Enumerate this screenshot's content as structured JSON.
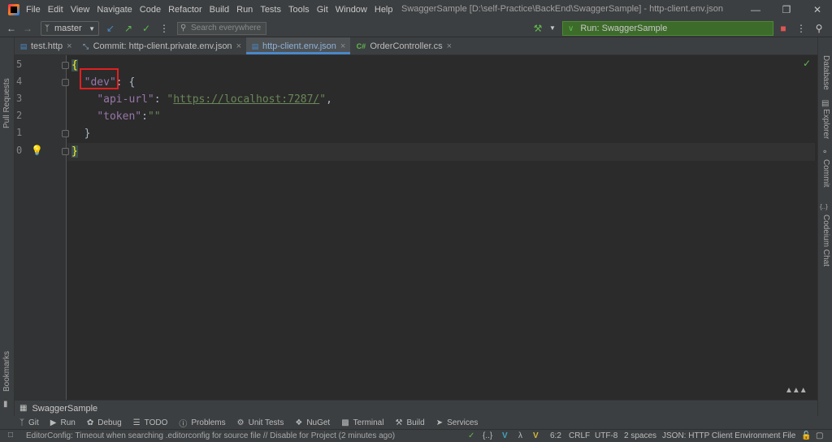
{
  "menu": [
    "File",
    "Edit",
    "View",
    "Navigate",
    "Code",
    "Refactor",
    "Build",
    "Run",
    "Tests",
    "Tools",
    "Git",
    "Window",
    "Help"
  ],
  "window_title": "SwaggerSample [D:\\self-Practice\\BackEnd\\SwaggerSample] - http-client.env.json",
  "toolbar": {
    "branch": "master",
    "search_placeholder": "Search everywhere",
    "run_config": "Run: SwaggerSample"
  },
  "left_stripe": {
    "pull_requests": "Pull Requests",
    "bookmarks": "Bookmarks"
  },
  "right_stripe": {
    "database": "Database",
    "explorer": "Explorer",
    "commit": "Commit",
    "codeium": "Codeium Chat"
  },
  "tabs": [
    {
      "label": "test.http",
      "active": false
    },
    {
      "label": "Commit: http-client.private.env.json",
      "active": false
    },
    {
      "label": "http-client.env.json",
      "active": true
    },
    {
      "label": "OrderController.cs",
      "active": false
    }
  ],
  "editor": {
    "line_numbers": [
      "5",
      "4",
      "3",
      "2",
      "1",
      "0"
    ],
    "lines": {
      "l1_open": "{",
      "l2_key": "\"dev\"",
      "l2_rest": ": {",
      "l3_key": "\"api-url\"",
      "l3_colon": ": ",
      "l3_q1": "\"",
      "l3_url": "https://localhost:7287/",
      "l3_q2": "\"",
      "l3_comma": ",",
      "l4_key": "\"token\"",
      "l4_colon": ":",
      "l4_val": "\"\"",
      "l5_close": "}",
      "l6_close": "}"
    }
  },
  "run_panel": {
    "title": "SwaggerSample"
  },
  "tool_windows": [
    "Git",
    "Run",
    "Debug",
    "TODO",
    "Problems",
    "Unit Tests",
    "NuGet",
    "Terminal",
    "Build",
    "Services"
  ],
  "status": {
    "message": "EditorConfig: Timeout when searching .editorconfig for source file // Disable for Project (2 minutes ago)",
    "braces": "{..}",
    "position": "6:2",
    "line_ending": "CRLF",
    "encoding": "UTF-8",
    "indent": "2 spaces",
    "schema": "JSON: HTTP Client Environment File"
  },
  "colors": {
    "accent": "#4a88c7",
    "run_green": "#3d6b2a",
    "highlight_red": "#e02020"
  }
}
